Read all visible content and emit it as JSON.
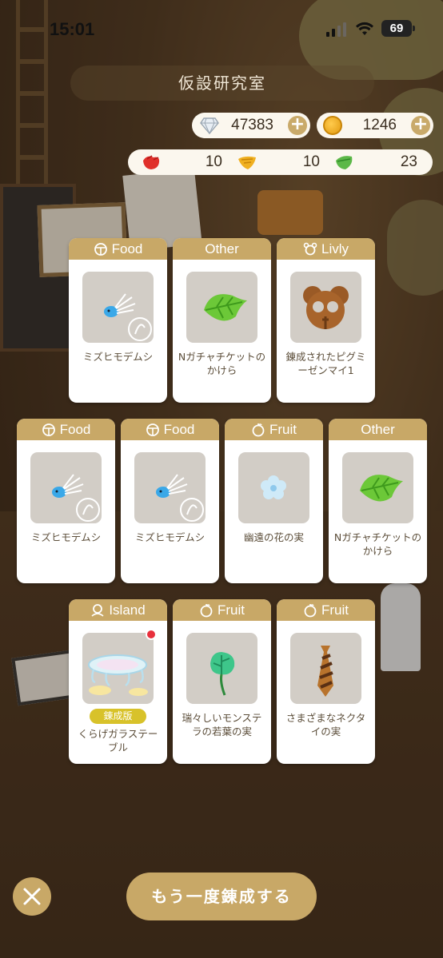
{
  "status_bar": {
    "time": "15:01",
    "battery": "69"
  },
  "header": {
    "title": "仮設研究室"
  },
  "currency": {
    "gems": "47383",
    "coins": "1246"
  },
  "resources": [
    {
      "icon": "red-material-icon",
      "value": "10",
      "color": "#e0302a"
    },
    {
      "icon": "yellow-material-icon",
      "value": "10",
      "color": "#f0b020"
    },
    {
      "icon": "green-material-icon",
      "value": "23",
      "color": "#5cb848"
    }
  ],
  "items": [
    {
      "category": "Food",
      "category_icon": "food-icon",
      "name": "ミズヒモデムシ",
      "thumb": "water-worm-icon"
    },
    {
      "category": "Other",
      "category_icon": "",
      "name": "Nガチャチケットのかけら",
      "thumb": "green-leaf-icon"
    },
    {
      "category": "Livly",
      "category_icon": "livly-icon",
      "name": "錬成されたピグミーゼンマイ1",
      "thumb": "pygmy-zenmai-icon"
    },
    {
      "category": "Food",
      "category_icon": "food-icon",
      "name": "ミズヒモデムシ",
      "thumb": "water-worm-icon"
    },
    {
      "category": "Food",
      "category_icon": "food-icon",
      "name": "ミズヒモデムシ",
      "thumb": "water-worm-icon"
    },
    {
      "category": "Fruit",
      "category_icon": "fruit-icon",
      "name": "幽遠の花の実",
      "thumb": "blue-flower-icon"
    },
    {
      "category": "Other",
      "category_icon": "",
      "name": "Nガチャチケットのかけら",
      "thumb": "green-leaf-icon"
    },
    {
      "category": "Island",
      "category_icon": "island-icon",
      "name": "くらげガラステーブル",
      "tag": "錬成版",
      "thumb": "jellyfish-table-icon",
      "new": true
    },
    {
      "category": "Fruit",
      "category_icon": "fruit-icon",
      "name": "瑞々しいモンステラの若葉の実",
      "thumb": "monstera-leaf-icon"
    },
    {
      "category": "Fruit",
      "category_icon": "fruit-icon",
      "name": "さまざまなネクタイの実",
      "thumb": "necktie-icon"
    }
  ],
  "footer": {
    "retry_label": "もう一度錬成する"
  },
  "colors": {
    "accent": "#c8a867",
    "card_bg": "#ffffff",
    "thumb_bg": "#d2cdc6"
  }
}
